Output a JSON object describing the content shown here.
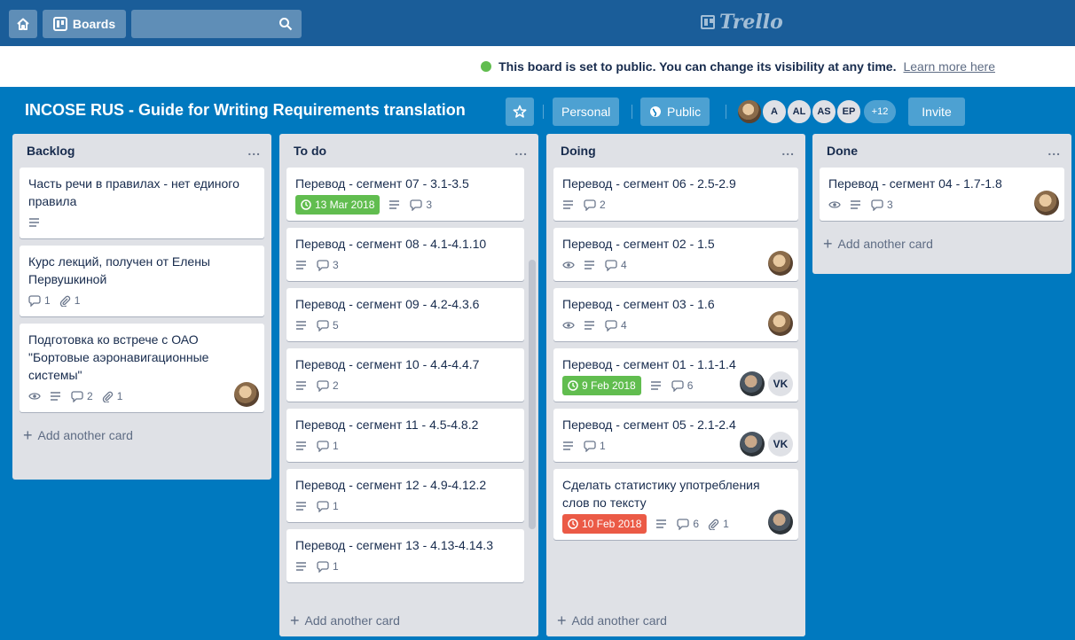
{
  "header": {
    "boards_label": "Boards",
    "logo_text": "Trello"
  },
  "notice": {
    "message": "This board is set to public. You can change its visibility at any time.",
    "link": "Learn more here"
  },
  "board": {
    "title": "INCOSE RUS - Guide for Writing Requirements translation",
    "team_label": "Personal",
    "visibility_label": "Public",
    "members": [
      "A",
      "AL",
      "AS",
      "EP"
    ],
    "more_members": "+12",
    "invite_label": "Invite",
    "background_color": "#0079bf"
  },
  "lists": [
    {
      "title": "Backlog",
      "menu": "...",
      "add_card": "Add another card",
      "cards": [
        {
          "title": "Часть речи в правилах - нет единого правила",
          "description": true
        },
        {
          "title": "Курс лекций, получен от Елены Первушкиной",
          "comments": "1",
          "attachments": "1"
        },
        {
          "title": "Подготовка ко встрече с ОАО \"Бортовые аэронавигационные системы\"",
          "watching": true,
          "description": true,
          "comments": "2",
          "attachments": "1",
          "avatars": [
            "photo"
          ]
        }
      ]
    },
    {
      "title": "To do",
      "menu": "...",
      "add_card": "Add another card",
      "cards": [
        {
          "title": "Перевод - сегмент 07 - 3.1-3.5",
          "due": "13 Mar 2018",
          "due_status": "complete",
          "description": true,
          "comments": "3"
        },
        {
          "title": "Перевод - сегмент 08 - 4.1-4.1.10",
          "description": true,
          "comments": "3"
        },
        {
          "title": "Перевод - сегмент 09 - 4.2-4.3.6",
          "description": true,
          "comments": "5"
        },
        {
          "title": "Перевод - сегмент 10 - 4.4-4.4.7",
          "description": true,
          "comments": "2"
        },
        {
          "title": "Перевод - сегмент 11 - 4.5-4.8.2",
          "description": true,
          "comments": "1"
        },
        {
          "title": "Перевод - сегмент 12 - 4.9-4.12.2",
          "description": true,
          "comments": "1"
        },
        {
          "title": "Перевод - сегмент 13 - 4.13-4.14.3",
          "description": true,
          "comments": "1"
        }
      ]
    },
    {
      "title": "Doing",
      "menu": "...",
      "add_card": "Add another card",
      "cards": [
        {
          "title": "Перевод - сегмент 06 - 2.5-2.9",
          "description": true,
          "comments": "2"
        },
        {
          "title": "Перевод - сегмент 02 - 1.5",
          "watching": true,
          "description": true,
          "comments": "4",
          "avatars": [
            "photo"
          ]
        },
        {
          "title": "Перевод - сегмент 03 - 1.6",
          "watching": true,
          "description": true,
          "comments": "4",
          "avatars": [
            "photo"
          ]
        },
        {
          "title": "Перевод - сегмент 01 - 1.1-1.4",
          "due": "9 Feb 2018",
          "due_status": "complete",
          "description": true,
          "comments": "6",
          "avatars": [
            "dark",
            "VK"
          ]
        },
        {
          "title": "Перевод - сегмент 05 - 2.1-2.4",
          "description": true,
          "comments": "1",
          "avatars": [
            "dark",
            "VK"
          ]
        },
        {
          "title": "Сделать статистику употребления слов по тексту",
          "due": "10 Feb 2018",
          "due_status": "overdue",
          "description": true,
          "comments": "6",
          "attachments": "1",
          "avatars": [
            "dark"
          ]
        }
      ]
    },
    {
      "title": "Done",
      "menu": "...",
      "add_card": "Add another card",
      "cards": [
        {
          "title": "Перевод - сегмент 04 - 1.7-1.8",
          "watching": true,
          "description": true,
          "comments": "3",
          "avatars": [
            "photo"
          ]
        }
      ]
    }
  ]
}
